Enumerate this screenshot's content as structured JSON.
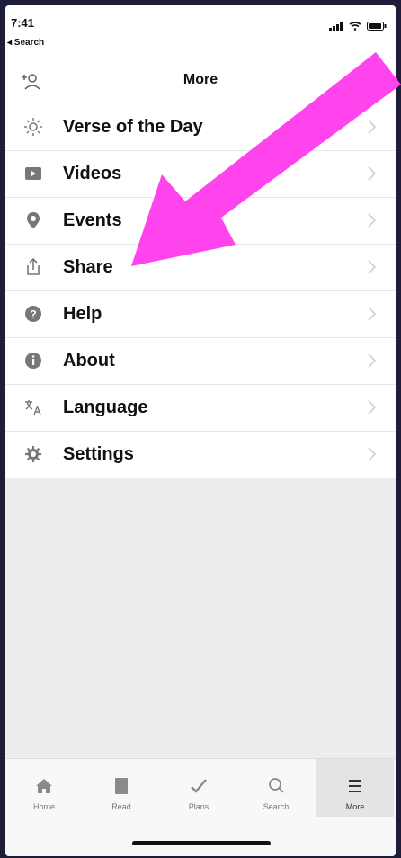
{
  "status_bar": {
    "time": "7:41",
    "back_label": "◂ Search"
  },
  "nav": {
    "title": "More"
  },
  "menu": [
    {
      "label": "Verse of the Day",
      "icon": "sun-icon"
    },
    {
      "label": "Videos",
      "icon": "video-icon"
    },
    {
      "label": "Events",
      "icon": "location-pin-icon"
    },
    {
      "label": "Share",
      "icon": "share-icon"
    },
    {
      "label": "Help",
      "icon": "help-icon"
    },
    {
      "label": "About",
      "icon": "info-icon"
    },
    {
      "label": "Language",
      "icon": "language-icon"
    },
    {
      "label": "Settings",
      "icon": "gear-icon"
    }
  ],
  "tabs": [
    {
      "label": "Home",
      "icon": "home-icon"
    },
    {
      "label": "Read",
      "icon": "book-icon"
    },
    {
      "label": "Plans",
      "icon": "checkmark-icon"
    },
    {
      "label": "Search",
      "icon": "search-icon"
    },
    {
      "label": "More",
      "icon": "menu-icon",
      "active": true
    }
  ],
  "colors": {
    "annotation_arrow": "#ff44ee",
    "background": "#ededed"
  }
}
